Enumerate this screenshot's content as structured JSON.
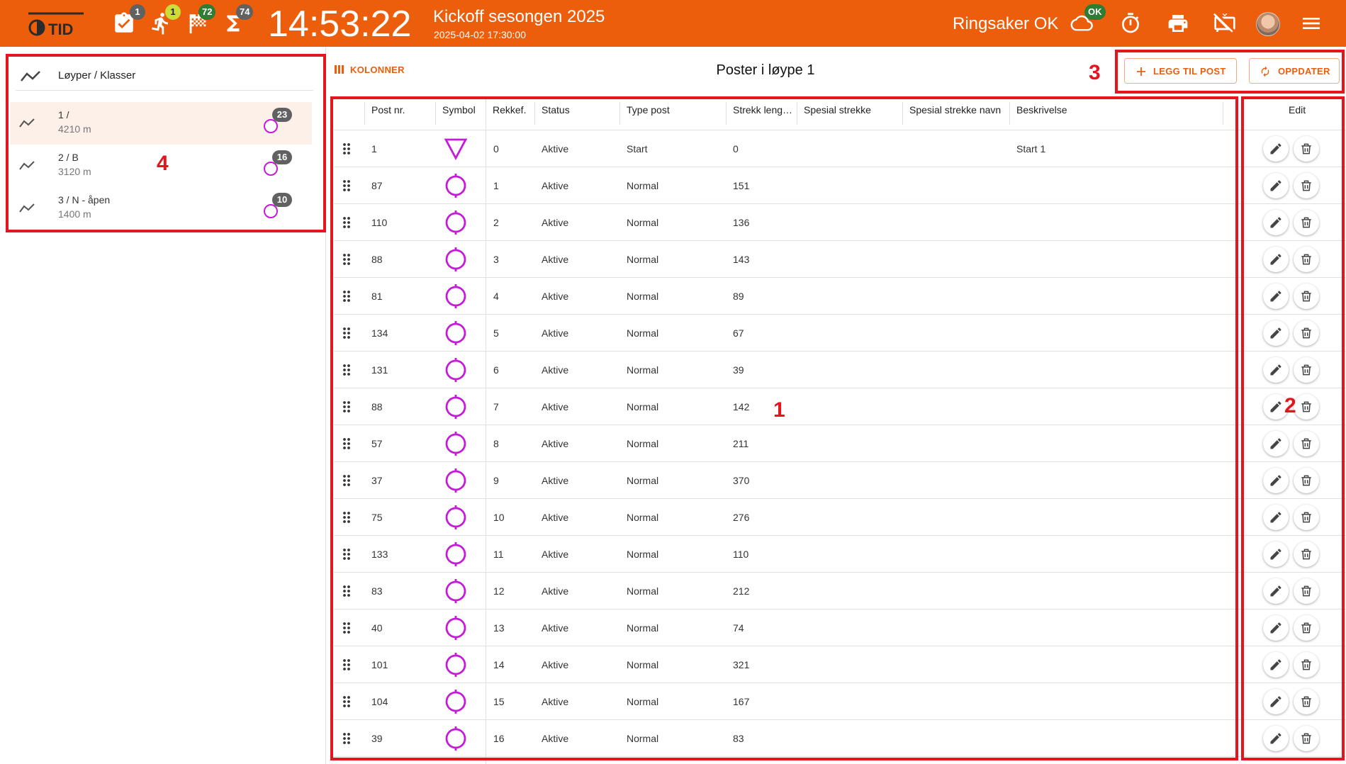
{
  "topbar": {
    "logo_text": "OTID",
    "badges": {
      "checklist": "1",
      "runner": "1",
      "finish": "72",
      "sum": "74"
    },
    "clock": "14:53:22",
    "event_title": "Kickoff sesongen 2025",
    "event_date": "2025-04-02 17:30:00",
    "club_name": "Ringsaker OK",
    "cloud_status": "OK"
  },
  "left_panel": {
    "header": "Løyper / Klasser",
    "courses": [
      {
        "name": "1 /",
        "length": "4210 m",
        "count": "23"
      },
      {
        "name": "2 / B",
        "length": "3120 m",
        "count": "16"
      },
      {
        "name": "3 / N - åpen",
        "length": "1400 m",
        "count": "10"
      }
    ]
  },
  "toolbar": {
    "columns_button": "KOLONNER",
    "title": "Poster i løype 1",
    "add_button": "LEGG TIL POST",
    "refresh_button": "OPPDATER"
  },
  "table": {
    "headers": {
      "post": "Post nr.",
      "symbol": "Symbol",
      "order": "Rekkef.",
      "status": "Status",
      "type": "Type post",
      "length": "Strekk leng…",
      "special": "Spesial strekke",
      "special_name": "Spesial strekke navn",
      "description": "Beskrivelse",
      "edit": "Edit"
    },
    "rows": [
      {
        "post": "1",
        "symbol": "start",
        "order": "0",
        "status": "Aktive",
        "type": "Start",
        "length": "0",
        "description": "Start 1"
      },
      {
        "post": "87",
        "symbol": "control",
        "order": "1",
        "status": "Aktive",
        "type": "Normal",
        "length": "151",
        "description": ""
      },
      {
        "post": "110",
        "symbol": "control",
        "order": "2",
        "status": "Aktive",
        "type": "Normal",
        "length": "136",
        "description": ""
      },
      {
        "post": "88",
        "symbol": "control",
        "order": "3",
        "status": "Aktive",
        "type": "Normal",
        "length": "143",
        "description": ""
      },
      {
        "post": "81",
        "symbol": "control",
        "order": "4",
        "status": "Aktive",
        "type": "Normal",
        "length": "89",
        "description": ""
      },
      {
        "post": "134",
        "symbol": "control",
        "order": "5",
        "status": "Aktive",
        "type": "Normal",
        "length": "67",
        "description": ""
      },
      {
        "post": "131",
        "symbol": "control",
        "order": "6",
        "status": "Aktive",
        "type": "Normal",
        "length": "39",
        "description": ""
      },
      {
        "post": "88",
        "symbol": "control",
        "order": "7",
        "status": "Aktive",
        "type": "Normal",
        "length": "142",
        "description": ""
      },
      {
        "post": "57",
        "symbol": "control",
        "order": "8",
        "status": "Aktive",
        "type": "Normal",
        "length": "211",
        "description": ""
      },
      {
        "post": "37",
        "symbol": "control",
        "order": "9",
        "status": "Aktive",
        "type": "Normal",
        "length": "370",
        "description": ""
      },
      {
        "post": "75",
        "symbol": "control",
        "order": "10",
        "status": "Aktive",
        "type": "Normal",
        "length": "276",
        "description": ""
      },
      {
        "post": "133",
        "symbol": "control",
        "order": "11",
        "status": "Aktive",
        "type": "Normal",
        "length": "110",
        "description": ""
      },
      {
        "post": "83",
        "symbol": "control",
        "order": "12",
        "status": "Aktive",
        "type": "Normal",
        "length": "212",
        "description": ""
      },
      {
        "post": "40",
        "symbol": "control",
        "order": "13",
        "status": "Aktive",
        "type": "Normal",
        "length": "74",
        "description": ""
      },
      {
        "post": "101",
        "symbol": "control",
        "order": "14",
        "status": "Aktive",
        "type": "Normal",
        "length": "321",
        "description": ""
      },
      {
        "post": "104",
        "symbol": "control",
        "order": "15",
        "status": "Aktive",
        "type": "Normal",
        "length": "167",
        "description": ""
      },
      {
        "post": "39",
        "symbol": "control",
        "order": "16",
        "status": "Aktive",
        "type": "Normal",
        "length": "83",
        "description": ""
      }
    ]
  },
  "annotations": {
    "a1": "1",
    "a2": "2",
    "a3": "3",
    "a4": "4"
  },
  "colors": {
    "brand": "#ec5e0c",
    "symbol": "#c51bd8",
    "annotation": "#e3151f",
    "selected_row": "#fdf0e8"
  }
}
